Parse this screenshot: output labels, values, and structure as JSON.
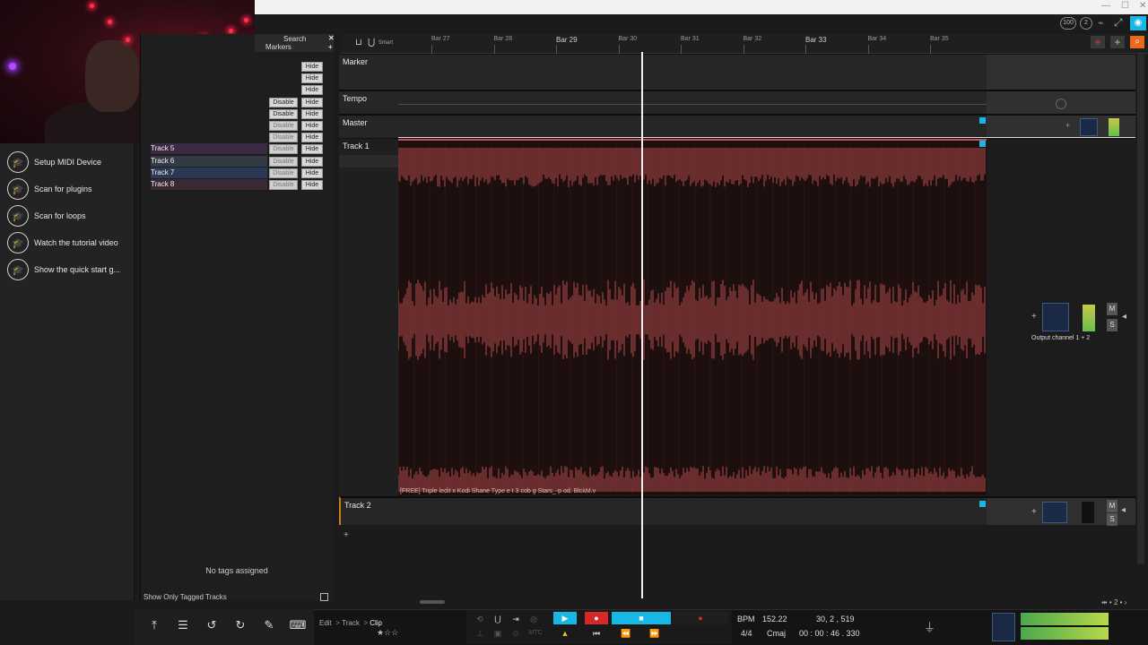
{
  "browser_panel": {
    "search_label": "Search",
    "markers_label": "Markers",
    "close_icon": "close-icon",
    "add_icon": "plus-icon"
  },
  "track_list": {
    "rows": [
      {
        "name": "",
        "disable": "",
        "hide": "Hide"
      },
      {
        "name": "",
        "disable": "",
        "hide": "Hide"
      },
      {
        "name": "",
        "disable": "",
        "hide": "Hide"
      },
      {
        "name": "",
        "disable": "Disable",
        "hide": "Hide"
      },
      {
        "name": "",
        "disable": "Disable",
        "hide": "Hide"
      },
      {
        "name": "",
        "disable": "Disable",
        "hide": "Hide"
      },
      {
        "name": "",
        "disable": "Disable",
        "hide": "Hide"
      },
      {
        "name": "Track 5",
        "disable": "Disable",
        "hide": "Hide"
      },
      {
        "name": "Track 6",
        "disable": "Disable",
        "hide": "Hide"
      },
      {
        "name": "Track 7",
        "disable": "Disable",
        "hide": "Hide"
      },
      {
        "name": "Track 8",
        "disable": "Disable",
        "hide": "Hide"
      }
    ],
    "no_tags": "No tags assigned",
    "show_only_tagged": "Show Only Tagged Tracks"
  },
  "help_panel": {
    "items": [
      {
        "label": "Setup MIDI Device",
        "icon": "graduation-cap-icon"
      },
      {
        "label": "Scan for plugins",
        "icon": "graduation-cap-icon"
      },
      {
        "label": "Scan for loops",
        "icon": "graduation-cap-icon"
      },
      {
        "label": "Watch the tutorial video",
        "icon": "graduation-cap-icon"
      },
      {
        "label": "Show the quick start g...",
        "icon": "graduation-cap-icon"
      }
    ]
  },
  "ruler": {
    "snap_label": "Smart",
    "bars": [
      {
        "label": "Bar 27",
        "big": false
      },
      {
        "label": "Bar 28",
        "big": false
      },
      {
        "label": "Bar 29",
        "big": true
      },
      {
        "label": "Bar 30",
        "big": false
      },
      {
        "label": "Bar 31",
        "big": false
      },
      {
        "label": "Bar 32",
        "big": false
      },
      {
        "label": "Bar 33",
        "big": true
      },
      {
        "label": "Bar 34",
        "big": false
      },
      {
        "label": "Bar 35",
        "big": false
      }
    ]
  },
  "lanes": {
    "marker": "Marker",
    "tempo": "Tempo",
    "master": "Master",
    "track1": "Track 1",
    "track2": "Track 2"
  },
  "clip": {
    "name": "[FREE] Triple  ledit x Kodi  Shane Type  e t 3 cob g Stars_-p od. BlckM.v"
  },
  "mixer": {
    "output_label": "Output channel 1 + 2",
    "mute": "M",
    "solo": "S"
  },
  "bottom_bar": {
    "breadcrumb": [
      "Edit",
      "Track",
      "Clip"
    ],
    "bpm_label": "BPM",
    "bpm_value": "152.22",
    "position": "30, 2 , 519",
    "time_sig": "4/4",
    "key": "Cmaj",
    "time": "00 : 00 : 46 . 330"
  },
  "topbar": {
    "zoom_label": "100",
    "cpu_label": "2"
  },
  "colors": {
    "clip_fill": "#1e0f0f",
    "waveform": "#8a3a3a",
    "accent_blue": "#17b7e6",
    "record_red": "#d62828"
  }
}
